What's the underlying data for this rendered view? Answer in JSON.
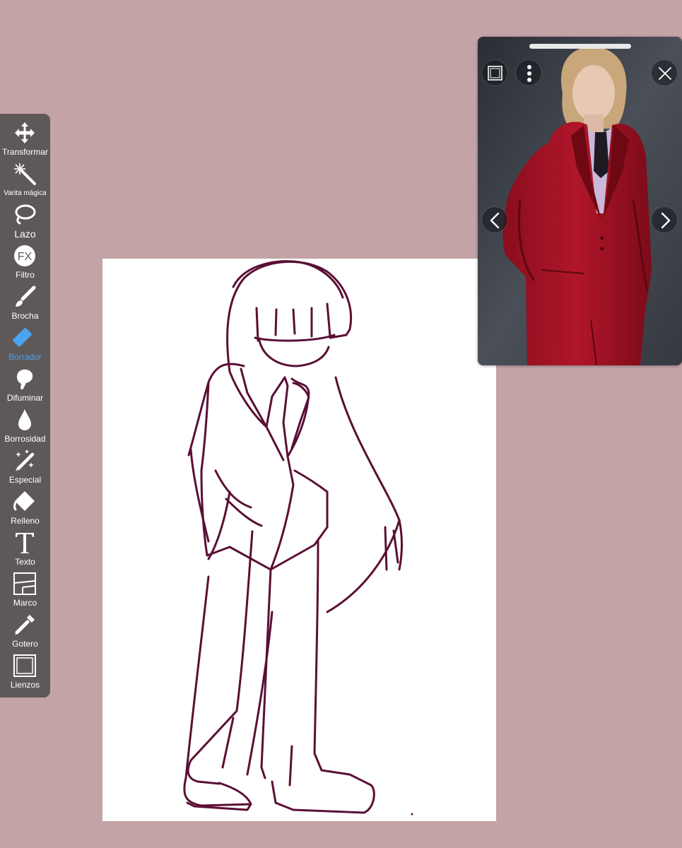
{
  "toolbar": {
    "tools": [
      {
        "label": "Transformar",
        "icon": "move-arrows-icon",
        "active": false
      },
      {
        "label": "Varita mágica",
        "icon": "magic-wand-icon",
        "active": false
      },
      {
        "label": "Lazo",
        "icon": "lasso-icon",
        "active": false
      },
      {
        "label": "Filtro",
        "icon": "fx-icon",
        "active": false
      },
      {
        "label": "Brocha",
        "icon": "brush-icon",
        "active": false
      },
      {
        "label": "Borrador",
        "icon": "eraser-icon",
        "active": true
      },
      {
        "label": "Difuminar",
        "icon": "smudge-finger-icon",
        "active": false
      },
      {
        "label": "Borrosidad",
        "icon": "blur-drop-icon",
        "active": false
      },
      {
        "label": "Especial",
        "icon": "special-pen-icon",
        "active": false
      },
      {
        "label": "Relleno",
        "icon": "fill-bucket-icon",
        "active": false
      },
      {
        "label": "Texto",
        "icon": "text-icon",
        "active": false
      },
      {
        "label": "Marco",
        "icon": "frame-icon",
        "active": false
      },
      {
        "label": "Gotero",
        "icon": "eyedropper-icon",
        "active": false
      },
      {
        "label": "Lienzos",
        "icon": "canvas-icon",
        "active": false
      }
    ],
    "active_color": "#4aa3ee"
  },
  "reference_window": {
    "icons": [
      "window-frame-icon",
      "more-vertical-icon",
      "close-icon",
      "chevron-left-icon",
      "chevron-right-icon"
    ],
    "image": "photo of a model in a red suit"
  },
  "colors": {
    "background": "#c3a3a5",
    "toolbar": "#5f5859",
    "sketch_line": "#5a0f35"
  }
}
